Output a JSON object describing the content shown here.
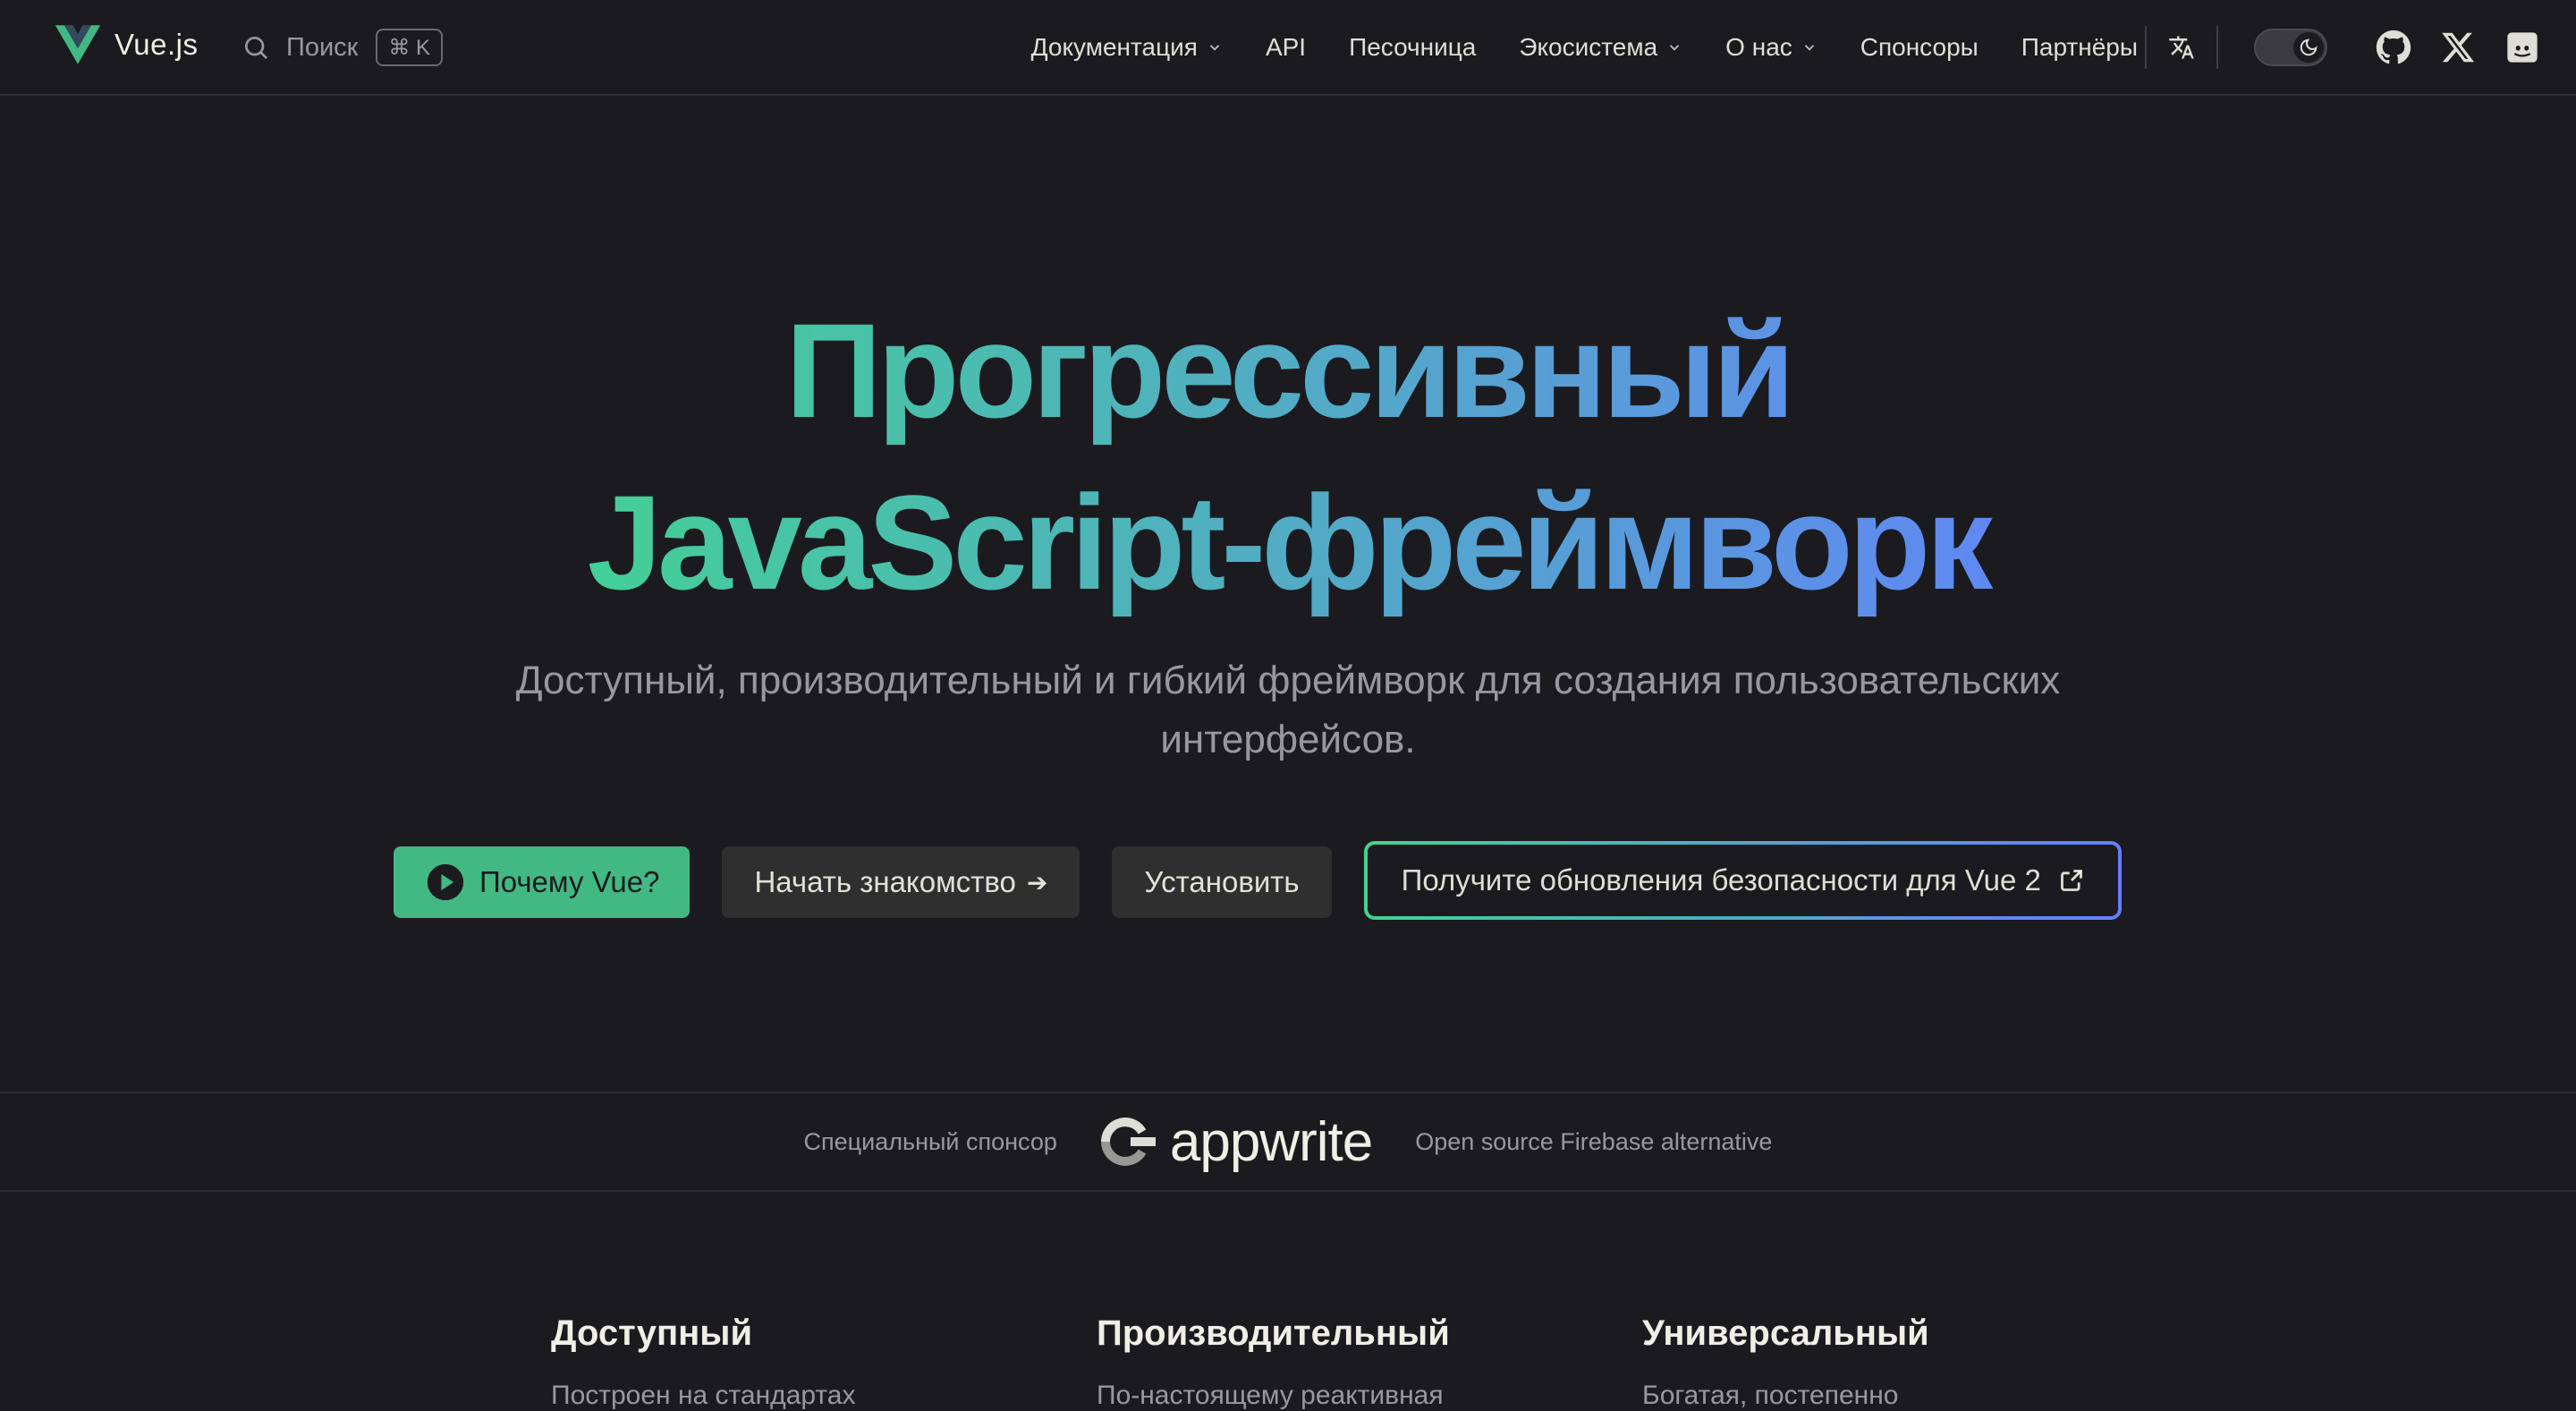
{
  "nav": {
    "logo_text": "Vue.js",
    "search_label": "Поиск",
    "search_shortcut": "⌘ K",
    "menu": [
      {
        "label": "Документация",
        "dropdown": true
      },
      {
        "label": "API",
        "dropdown": false
      },
      {
        "label": "Песочница",
        "dropdown": false
      },
      {
        "label": "Экосистема",
        "dropdown": true
      },
      {
        "label": "О нас",
        "dropdown": true
      },
      {
        "label": "Спонсоры",
        "dropdown": false
      },
      {
        "label": "Партнёры",
        "dropdown": false
      }
    ],
    "icons": [
      "translate-icon",
      "theme-toggle",
      "github-icon",
      "x-twitter-icon",
      "discord-icon"
    ]
  },
  "hero": {
    "title_line1": "Прогрессивный",
    "title_line2": "JavaScript-фреймворк",
    "tagline": "Доступный, производительный и гибкий фреймворк для создания пользовательских интерфейсов."
  },
  "actions": {
    "why_vue": "Почему Vue?",
    "get_started": "Начать знакомство",
    "install": "Установить",
    "security": "Получите обновления безопасности для Vue 2"
  },
  "sponsor": {
    "label": "Специальный спонсор",
    "name": "appwrite",
    "description": "Open source Firebase alternative"
  },
  "features": [
    {
      "title": "Доступный",
      "text": "Построен на стандартах"
    },
    {
      "title": "Производительный",
      "text": "По-настоящему реактивная"
    },
    {
      "title": "Универсальный",
      "text": "Богатая, постепенно"
    }
  ],
  "colors": {
    "background": "#1b1b1f",
    "brand": "#42b883",
    "gradient_start": "#42d392",
    "gradient_end": "#647eff"
  }
}
